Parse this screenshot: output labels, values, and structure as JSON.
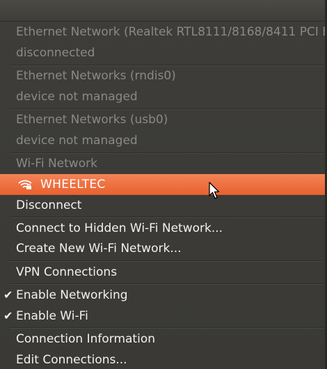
{
  "menu": {
    "items": [
      {
        "label": "Ethernet Network (Realtek RTL8111/8168/8411 PCI E",
        "enabled": false
      },
      {
        "label": "disconnected",
        "enabled": false
      },
      {
        "label": "Ethernet Networks (rndis0)",
        "enabled": false
      },
      {
        "label": "device not managed",
        "enabled": false
      },
      {
        "label": "Ethernet Networks (usb0)",
        "enabled": false
      },
      {
        "label": "device not managed",
        "enabled": false
      },
      {
        "label": "Wi-Fi Network",
        "enabled": false
      },
      {
        "label": "WHEELTEC",
        "selected": true,
        "icon": "wifi-locked-icon"
      },
      {
        "label": "Disconnect"
      },
      {
        "label": "Connect to Hidden Wi-Fi Network..."
      },
      {
        "label": "Create New Wi-Fi Network..."
      },
      {
        "label": "VPN Connections"
      },
      {
        "label": "Enable Networking",
        "checked": true
      },
      {
        "label": "Enable Wi-Fi",
        "checked": true
      },
      {
        "label": "Connection Information"
      },
      {
        "label": "Edit Connections..."
      }
    ],
    "check_glyph": "✔"
  },
  "colors": {
    "background": "#3c3b37",
    "highlight": "#e8612e",
    "text": "#f2f1f0",
    "disabled_text": "#8a8985"
  }
}
